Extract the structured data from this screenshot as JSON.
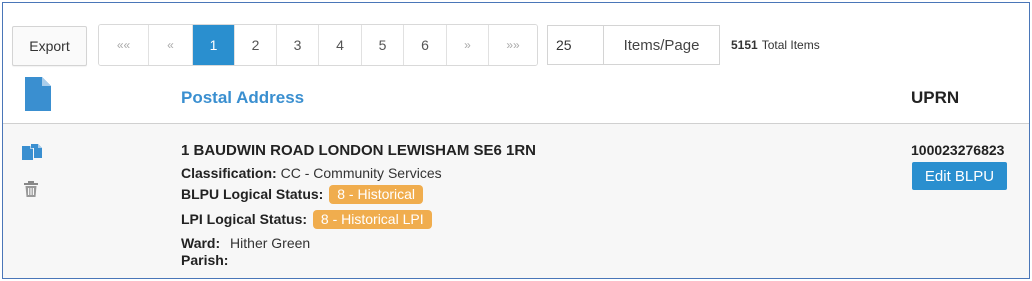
{
  "toolbar": {
    "export_label": "Export",
    "pagination": [
      {
        "label": "««",
        "nav": true
      },
      {
        "label": "«",
        "nav": true
      },
      {
        "label": "1",
        "active": true
      },
      {
        "label": "2"
      },
      {
        "label": "3"
      },
      {
        "label": "4"
      },
      {
        "label": "5"
      },
      {
        "label": "6"
      },
      {
        "label": "»",
        "nav": true
      },
      {
        "label": "»»",
        "nav": true
      }
    ],
    "items_per_page_value": "25",
    "items_per_page_label": "Items/Page",
    "total_count": "5151",
    "total_label": "Total Items"
  },
  "table": {
    "header": {
      "address_label": "Postal Address",
      "uprn_label": "UPRN"
    },
    "row": {
      "address": "1 BAUDWIN ROAD LONDON LEWISHAM SE6 1RN",
      "classification_key": "Classification:",
      "classification_value": "CC - Community Services",
      "blpu_key": "BLPU Logical Status:",
      "blpu_value": "8 - Historical",
      "lpi_key": "LPI Logical Status:",
      "lpi_value": "8 - Historical LPI",
      "ward_key": "Ward:",
      "ward_value": "Hither Green",
      "parish_key": "Parish:",
      "parish_value": "",
      "uprn_value": "100023276823",
      "edit_label": "Edit BLPU"
    }
  },
  "colors": {
    "accent": "#2a8fcf",
    "header_link": "#3a8fd0",
    "badge": "#f0ad4e",
    "frame_border": "#4a76b8"
  },
  "icons": [
    "document-icon",
    "copy-icon",
    "trash-icon"
  ]
}
